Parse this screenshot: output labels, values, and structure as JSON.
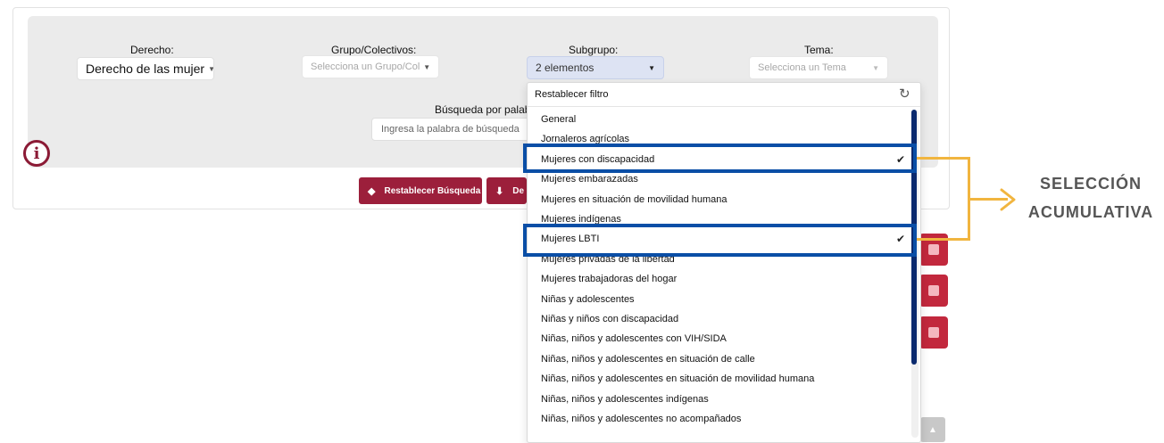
{
  "filters": {
    "derecho": {
      "label": "Derecho:",
      "value": "Derecho de las mujer"
    },
    "grupo": {
      "label": "Grupo/Colectivos:",
      "placeholder": "Selecciona un Grupo/Col"
    },
    "subgrupo": {
      "label": "Subgrupo:",
      "value": "2 elementos"
    },
    "tema": {
      "label": "Tema:",
      "placeholder": "Selecciona un Tema"
    },
    "keyword": {
      "label": "Búsqueda por palabr",
      "placeholder": "Ingresa la palabra de búsqueda"
    }
  },
  "buttons": {
    "reset_search": "Restablecer Búsqueda",
    "download": "De"
  },
  "dropdown": {
    "reset_label": "Restablecer filtro",
    "options": [
      {
        "label": "General",
        "selected": false
      },
      {
        "label": "Jornaleros agrícolas",
        "selected": false
      },
      {
        "label": "Mujeres con discapacidad",
        "selected": true
      },
      {
        "label": "Mujeres embarazadas",
        "selected": false
      },
      {
        "label": "Mujeres en situación de movilidad humana",
        "selected": false
      },
      {
        "label": "Mujeres indígenas",
        "selected": false
      },
      {
        "label": "Mujeres LBTI",
        "selected": true
      },
      {
        "label": "Mujeres privadas de la libertad",
        "selected": false
      },
      {
        "label": "Mujeres trabajadoras del hogar",
        "selected": false
      },
      {
        "label": "Niñas y adolescentes",
        "selected": false
      },
      {
        "label": "Niñas y niños con discapacidad",
        "selected": false
      },
      {
        "label": "Niñas, niños y adolescentes con VIH/SIDA",
        "selected": false
      },
      {
        "label": "Niñas, niños y adolescentes en situación de calle",
        "selected": false
      },
      {
        "label": "Niñas, niños y adolescentes en situación de movilidad humana",
        "selected": false
      },
      {
        "label": "Niñas, niños y adolescentes indígenas",
        "selected": false
      },
      {
        "label": "Niñas, niños y adolescentes no acompañados",
        "selected": false
      }
    ]
  },
  "annotation": {
    "line1": "SELECCIÓN",
    "line2": "ACUMULATIVA"
  },
  "icons": {
    "info": "info-icon",
    "caret": "caret-down-icon",
    "refresh": "refresh-icon",
    "check": "check-icon",
    "eraser": "eraser-icon",
    "download": "download-icon",
    "minus": "minus-icon",
    "scroll_top": "chevron-up-icon"
  },
  "colors": {
    "brand_maroon": "#9c1f3b",
    "highlight_blue": "#0a4ea6",
    "annotation_yellow": "#f1b53f",
    "scroll_thumb": "#0b2a6e",
    "side_button_red": "#c2283d"
  }
}
